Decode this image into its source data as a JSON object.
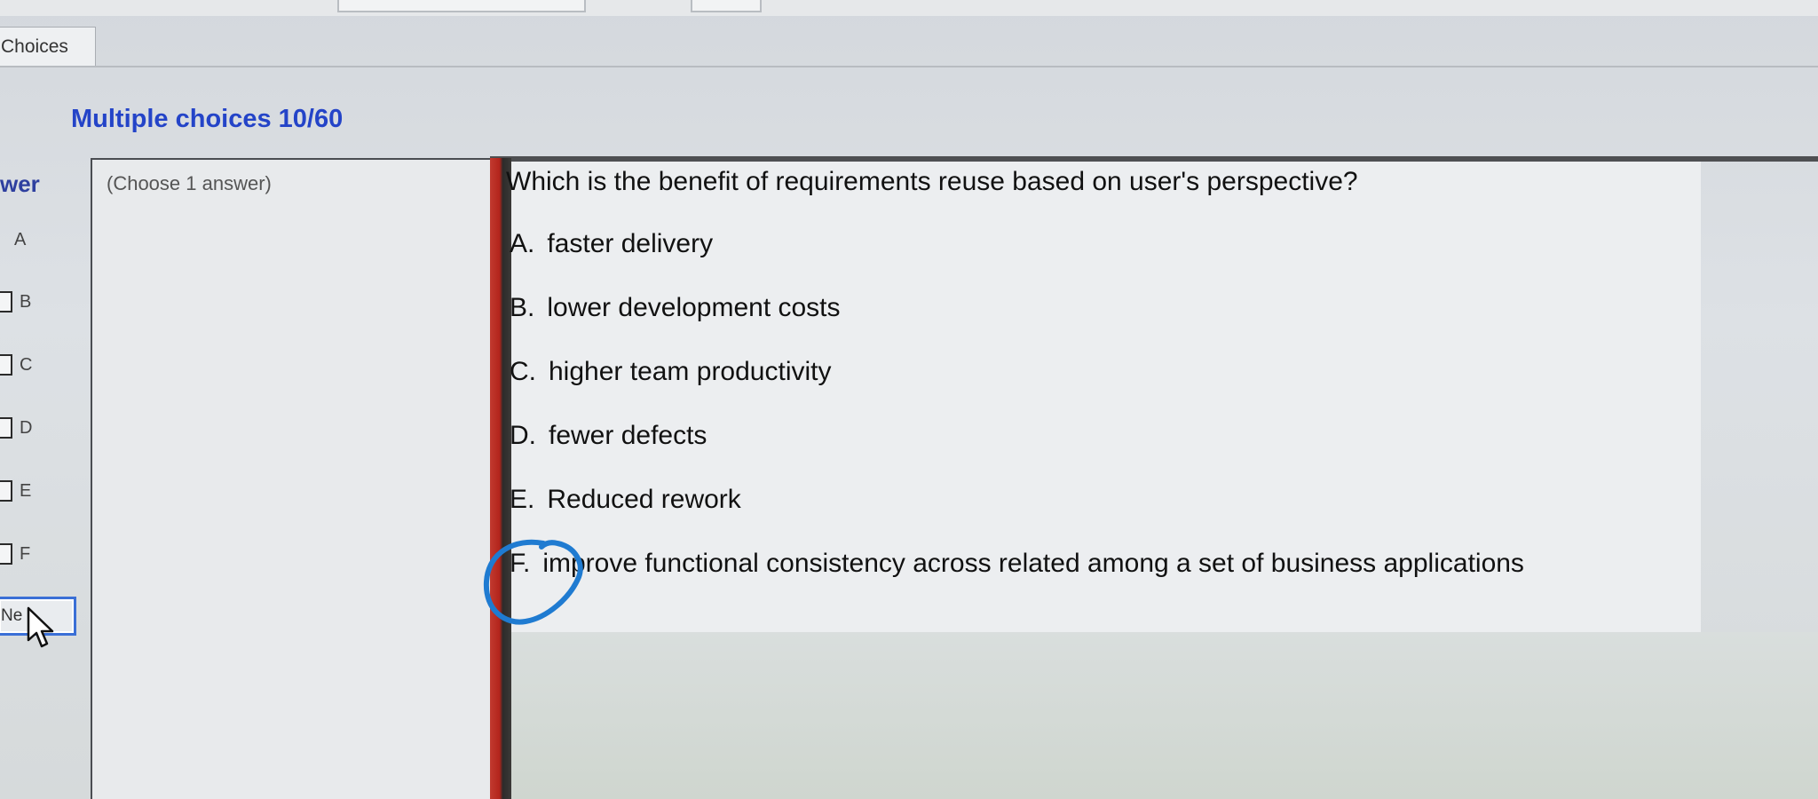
{
  "tabs": {
    "choices_label": "Choices"
  },
  "section": {
    "title": "Multiple choices 10/60"
  },
  "answer_column": {
    "header": "wer",
    "choices": [
      "A",
      "B",
      "C",
      "D",
      "E",
      "F"
    ],
    "next_label": "Ne"
  },
  "instruction": {
    "text": "(Choose 1 answer)"
  },
  "question": {
    "text": "Which is the benefit of requirements reuse based on user's perspective?",
    "options": [
      {
        "letter": "A.",
        "text": "faster delivery"
      },
      {
        "letter": "B.",
        "text": "lower development costs"
      },
      {
        "letter": "C.",
        "text": "higher team productivity"
      },
      {
        "letter": "D.",
        "text": "fewer defects"
      },
      {
        "letter": "E.",
        "text": "Reduced rework"
      },
      {
        "letter": "F.",
        "text": "improve functional consistency across related among a set of business applications"
      }
    ]
  },
  "colors": {
    "title_blue": "#2444c8",
    "divider_red": "#c13a30",
    "annotation_circle": "#1f7bd1"
  },
  "icons": [
    "cursor-arrow-icon",
    "handwritten-circle-annotation"
  ]
}
